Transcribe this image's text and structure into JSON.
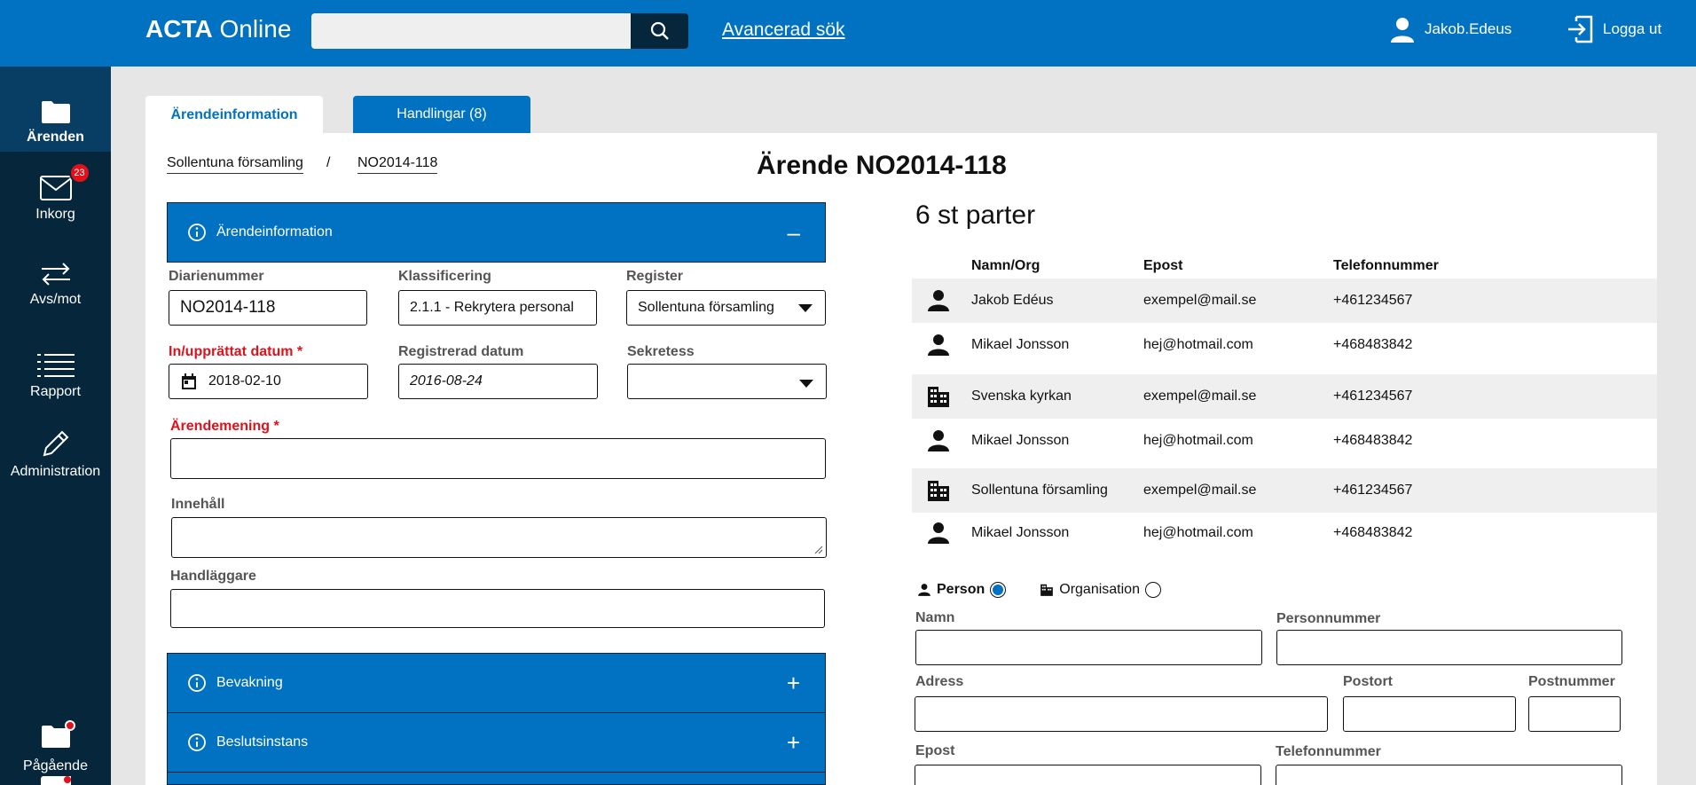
{
  "header": {
    "brand_bold": "ACTA",
    "brand_rest": "Online",
    "search_placeholder": "",
    "advanced_search": "Avancerad sök",
    "username": "Jakob.Edeus",
    "logout": "Logga ut"
  },
  "sidebar": {
    "items": [
      {
        "label": "Ärenden",
        "icon": "folder-icon",
        "active": true
      },
      {
        "label": "Inkorg",
        "icon": "mail-icon",
        "badge": "23"
      },
      {
        "label": "Avs/mot",
        "icon": "arrows-icon"
      },
      {
        "label": "Rapport",
        "icon": "list-icon"
      },
      {
        "label": "Administration",
        "icon": "pencil-icon"
      },
      {
        "label": "Pågående",
        "icon": "folder-icon"
      }
    ]
  },
  "tabs": [
    {
      "label": "Ärendeinformation",
      "active": true
    },
    {
      "label": "Handlingar (8)",
      "active": false
    }
  ],
  "breadcrumb": {
    "parent": "Sollentuna församling",
    "separator": "/",
    "current": "NO2014-118"
  },
  "page_title": "Ärende NO2014-118",
  "accordions": {
    "info": {
      "label": "Ärendeinformation",
      "toggle": "–"
    },
    "bevakning": {
      "label": "Bevakning",
      "toggle": "+"
    },
    "beslutsinstans": {
      "label": "Beslutsinstans",
      "toggle": "+"
    }
  },
  "form": {
    "diarienummer_label": "Diarienummer",
    "diarienummer_value": "NO2014-118",
    "klassificering_label": "Klassificering",
    "klassificering_value": "2.1.1 - Rekrytera personal",
    "register_label": "Register",
    "register_value": "Sollentuna församling",
    "upprattat_label": "In/upprättat datum *",
    "upprattat_value": "2018-02-10",
    "registrerad_label": "Registrerad datum",
    "registrerad_value": "2016-08-24",
    "sekretess_label": "Sekretess",
    "sekretess_value": "",
    "arendemening_label": "Ärendemening *",
    "innehall_label": "Innehåll",
    "handlaggare_label": "Handläggare"
  },
  "parties": {
    "title": "6 st parter",
    "columns": [
      "Namn/Org",
      "Epost",
      "Telefonnummer"
    ],
    "rows": [
      {
        "type": "person",
        "name": "Jakob Edéus",
        "email": "exempel@mail.se",
        "phone": "+461234567"
      },
      {
        "type": "person",
        "name": "Mikael Jonsson",
        "email": "hej@hotmail.com",
        "phone": "+468483842"
      },
      {
        "type": "org",
        "name": "Svenska kyrkan",
        "email": "exempel@mail.se",
        "phone": "+461234567"
      },
      {
        "type": "person",
        "name": "Mikael Jonsson",
        "email": "hej@hotmail.com",
        "phone": "+468483842"
      },
      {
        "type": "org",
        "name": "Sollentuna församling",
        "email": "exempel@mail.se",
        "phone": "+461234567"
      },
      {
        "type": "person",
        "name": "Mikael Jonsson",
        "email": "hej@hotmail.com",
        "phone": "+468483842"
      }
    ]
  },
  "party_form": {
    "person_label": "Person",
    "organisation_label": "Organisation",
    "namn_label": "Namn",
    "personnummer_label": "Personnummer",
    "adress_label": "Adress",
    "postort_label": "Postort",
    "postnummer_label": "Postnummer",
    "epost_label": "Epost",
    "telefon_label": "Telefonnummer"
  },
  "colors": {
    "primary": "#0072c1",
    "dark": "#06263b",
    "badge": "#e2101a"
  }
}
